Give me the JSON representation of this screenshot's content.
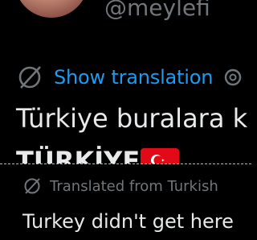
{
  "profile": {
    "handle": "@meylefi"
  },
  "translation": {
    "show_label": "Show translation"
  },
  "tweet": {
    "line1": "Türkiye buralara k",
    "line2": "TÜRKİYE"
  },
  "popup": {
    "label": "Translated from Turkish",
    "text": "Turkey didn't get here"
  },
  "colors": {
    "background": "#000000",
    "link": "#1d9bf0",
    "muted": "#71767b",
    "text": "#e7e9ea",
    "popup_border": "#d8c23a",
    "flag": "#e30a17"
  },
  "icons": {
    "translate": "translate-globe-icon",
    "settings": "gear-icon",
    "flag": "turkey-flag-icon"
  }
}
